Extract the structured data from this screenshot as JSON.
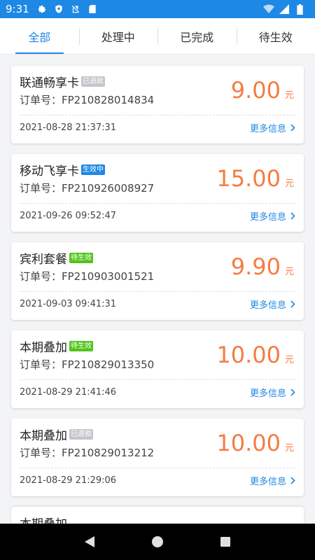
{
  "status_bar": {
    "time": "9:31",
    "icons_left": [
      "gear-icon",
      "shield-icon",
      "sim-card-icon",
      "sd-card-icon"
    ],
    "icons_right": [
      "wifi-icon",
      "signal-icon",
      "battery-icon"
    ]
  },
  "tabs": [
    {
      "label": "全部",
      "active": true
    },
    {
      "label": "处理中",
      "active": false
    },
    {
      "label": "已完成",
      "active": false
    },
    {
      "label": "待生效",
      "active": false
    }
  ],
  "orders": [
    {
      "title": "联通畅享卡",
      "badge": "已退款",
      "badge_color": "#c3c7cc",
      "order_no": "订单号：FP210828014834",
      "amount": "9.00",
      "unit": "元",
      "date": "2021-08-28 21:37:31",
      "more": "更多信息"
    },
    {
      "title": "移动飞享卡",
      "badge": "生效中",
      "badge_color": "#1e88e5",
      "order_no": "订单号：FP210926008927",
      "amount": "15.00",
      "unit": "元",
      "date": "2021-09-26 09:52:47",
      "more": "更多信息"
    },
    {
      "title": "宾利套餐",
      "badge": "待生效",
      "badge_color": "#52c41a",
      "order_no": "订单号：FP210903001521",
      "amount": "9.90",
      "unit": "元",
      "date": "2021-09-03 09:41:31",
      "more": "更多信息"
    },
    {
      "title": "本期叠加",
      "badge": "待生效",
      "badge_color": "#52c41a",
      "order_no": "订单号：FP210829013350",
      "amount": "10.00",
      "unit": "元",
      "date": "2021-08-29 21:41:46",
      "more": "更多信息"
    },
    {
      "title": "本期叠加",
      "badge": "已退款",
      "badge_color": "#c3c7cc",
      "order_no": "订单号：FP210829013212",
      "amount": "10.00",
      "unit": "元",
      "date": "2021-08-29 21:29:06",
      "more": "更多信息"
    }
  ],
  "partial_order": {
    "title": "本期叠加"
  },
  "colors": {
    "accent": "#1e88e5",
    "amount": "#f57c42"
  }
}
